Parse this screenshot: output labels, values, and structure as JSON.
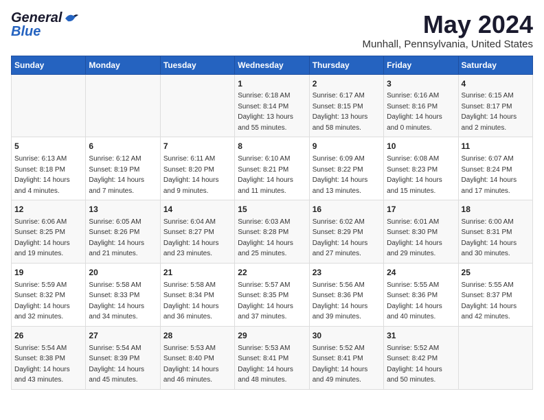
{
  "header": {
    "logo_general": "General",
    "logo_blue": "Blue",
    "title": "May 2024",
    "subtitle": "Munhall, Pennsylvania, United States"
  },
  "days_of_week": [
    "Sunday",
    "Monday",
    "Tuesday",
    "Wednesday",
    "Thursday",
    "Friday",
    "Saturday"
  ],
  "weeks": [
    [
      {
        "day": "",
        "sunrise": "",
        "sunset": "",
        "daylight": ""
      },
      {
        "day": "",
        "sunrise": "",
        "sunset": "",
        "daylight": ""
      },
      {
        "day": "",
        "sunrise": "",
        "sunset": "",
        "daylight": ""
      },
      {
        "day": "1",
        "sunrise": "Sunrise: 6:18 AM",
        "sunset": "Sunset: 8:14 PM",
        "daylight": "Daylight: 13 hours and 55 minutes."
      },
      {
        "day": "2",
        "sunrise": "Sunrise: 6:17 AM",
        "sunset": "Sunset: 8:15 PM",
        "daylight": "Daylight: 13 hours and 58 minutes."
      },
      {
        "day": "3",
        "sunrise": "Sunrise: 6:16 AM",
        "sunset": "Sunset: 8:16 PM",
        "daylight": "Daylight: 14 hours and 0 minutes."
      },
      {
        "day": "4",
        "sunrise": "Sunrise: 6:15 AM",
        "sunset": "Sunset: 8:17 PM",
        "daylight": "Daylight: 14 hours and 2 minutes."
      }
    ],
    [
      {
        "day": "5",
        "sunrise": "Sunrise: 6:13 AM",
        "sunset": "Sunset: 8:18 PM",
        "daylight": "Daylight: 14 hours and 4 minutes."
      },
      {
        "day": "6",
        "sunrise": "Sunrise: 6:12 AM",
        "sunset": "Sunset: 8:19 PM",
        "daylight": "Daylight: 14 hours and 7 minutes."
      },
      {
        "day": "7",
        "sunrise": "Sunrise: 6:11 AM",
        "sunset": "Sunset: 8:20 PM",
        "daylight": "Daylight: 14 hours and 9 minutes."
      },
      {
        "day": "8",
        "sunrise": "Sunrise: 6:10 AM",
        "sunset": "Sunset: 8:21 PM",
        "daylight": "Daylight: 14 hours and 11 minutes."
      },
      {
        "day": "9",
        "sunrise": "Sunrise: 6:09 AM",
        "sunset": "Sunset: 8:22 PM",
        "daylight": "Daylight: 14 hours and 13 minutes."
      },
      {
        "day": "10",
        "sunrise": "Sunrise: 6:08 AM",
        "sunset": "Sunset: 8:23 PM",
        "daylight": "Daylight: 14 hours and 15 minutes."
      },
      {
        "day": "11",
        "sunrise": "Sunrise: 6:07 AM",
        "sunset": "Sunset: 8:24 PM",
        "daylight": "Daylight: 14 hours and 17 minutes."
      }
    ],
    [
      {
        "day": "12",
        "sunrise": "Sunrise: 6:06 AM",
        "sunset": "Sunset: 8:25 PM",
        "daylight": "Daylight: 14 hours and 19 minutes."
      },
      {
        "day": "13",
        "sunrise": "Sunrise: 6:05 AM",
        "sunset": "Sunset: 8:26 PM",
        "daylight": "Daylight: 14 hours and 21 minutes."
      },
      {
        "day": "14",
        "sunrise": "Sunrise: 6:04 AM",
        "sunset": "Sunset: 8:27 PM",
        "daylight": "Daylight: 14 hours and 23 minutes."
      },
      {
        "day": "15",
        "sunrise": "Sunrise: 6:03 AM",
        "sunset": "Sunset: 8:28 PM",
        "daylight": "Daylight: 14 hours and 25 minutes."
      },
      {
        "day": "16",
        "sunrise": "Sunrise: 6:02 AM",
        "sunset": "Sunset: 8:29 PM",
        "daylight": "Daylight: 14 hours and 27 minutes."
      },
      {
        "day": "17",
        "sunrise": "Sunrise: 6:01 AM",
        "sunset": "Sunset: 8:30 PM",
        "daylight": "Daylight: 14 hours and 29 minutes."
      },
      {
        "day": "18",
        "sunrise": "Sunrise: 6:00 AM",
        "sunset": "Sunset: 8:31 PM",
        "daylight": "Daylight: 14 hours and 30 minutes."
      }
    ],
    [
      {
        "day": "19",
        "sunrise": "Sunrise: 5:59 AM",
        "sunset": "Sunset: 8:32 PM",
        "daylight": "Daylight: 14 hours and 32 minutes."
      },
      {
        "day": "20",
        "sunrise": "Sunrise: 5:58 AM",
        "sunset": "Sunset: 8:33 PM",
        "daylight": "Daylight: 14 hours and 34 minutes."
      },
      {
        "day": "21",
        "sunrise": "Sunrise: 5:58 AM",
        "sunset": "Sunset: 8:34 PM",
        "daylight": "Daylight: 14 hours and 36 minutes."
      },
      {
        "day": "22",
        "sunrise": "Sunrise: 5:57 AM",
        "sunset": "Sunset: 8:35 PM",
        "daylight": "Daylight: 14 hours and 37 minutes."
      },
      {
        "day": "23",
        "sunrise": "Sunrise: 5:56 AM",
        "sunset": "Sunset: 8:36 PM",
        "daylight": "Daylight: 14 hours and 39 minutes."
      },
      {
        "day": "24",
        "sunrise": "Sunrise: 5:55 AM",
        "sunset": "Sunset: 8:36 PM",
        "daylight": "Daylight: 14 hours and 40 minutes."
      },
      {
        "day": "25",
        "sunrise": "Sunrise: 5:55 AM",
        "sunset": "Sunset: 8:37 PM",
        "daylight": "Daylight: 14 hours and 42 minutes."
      }
    ],
    [
      {
        "day": "26",
        "sunrise": "Sunrise: 5:54 AM",
        "sunset": "Sunset: 8:38 PM",
        "daylight": "Daylight: 14 hours and 43 minutes."
      },
      {
        "day": "27",
        "sunrise": "Sunrise: 5:54 AM",
        "sunset": "Sunset: 8:39 PM",
        "daylight": "Daylight: 14 hours and 45 minutes."
      },
      {
        "day": "28",
        "sunrise": "Sunrise: 5:53 AM",
        "sunset": "Sunset: 8:40 PM",
        "daylight": "Daylight: 14 hours and 46 minutes."
      },
      {
        "day": "29",
        "sunrise": "Sunrise: 5:53 AM",
        "sunset": "Sunset: 8:41 PM",
        "daylight": "Daylight: 14 hours and 48 minutes."
      },
      {
        "day": "30",
        "sunrise": "Sunrise: 5:52 AM",
        "sunset": "Sunset: 8:41 PM",
        "daylight": "Daylight: 14 hours and 49 minutes."
      },
      {
        "day": "31",
        "sunrise": "Sunrise: 5:52 AM",
        "sunset": "Sunset: 8:42 PM",
        "daylight": "Daylight: 14 hours and 50 minutes."
      },
      {
        "day": "",
        "sunrise": "",
        "sunset": "",
        "daylight": ""
      }
    ]
  ]
}
